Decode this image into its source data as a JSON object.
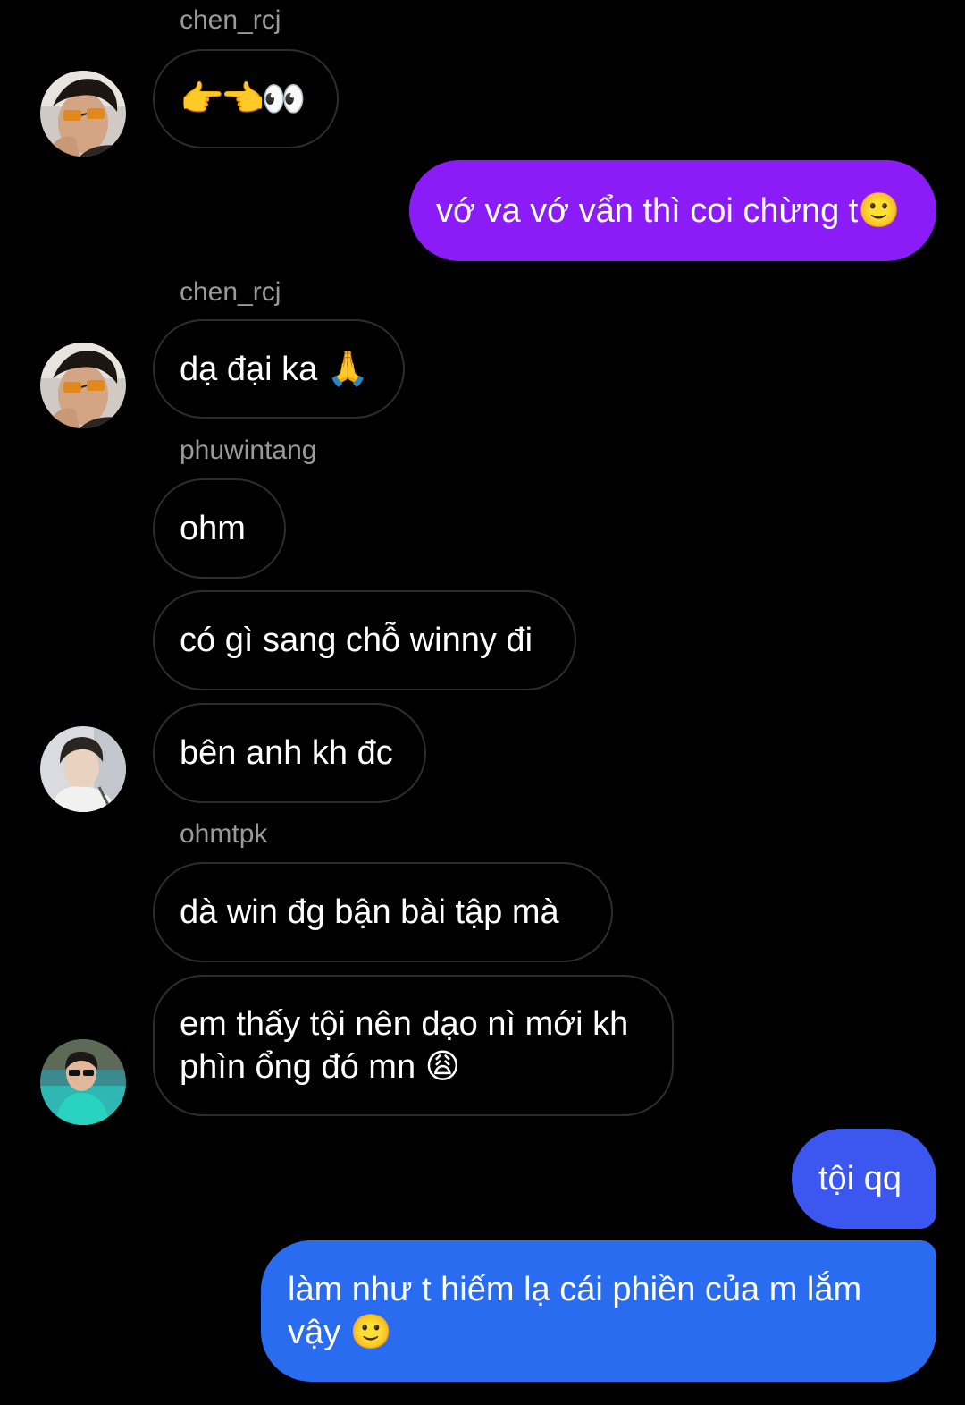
{
  "messages": {
    "m1": {
      "sender": "chen_rcj",
      "text": "👉👈👀"
    },
    "m2": {
      "text": "vớ va vớ vẩn thì coi chừng t🙂"
    },
    "m3": {
      "sender": "chen_rcj",
      "text": "dạ đại ka 🙏"
    },
    "m4": {
      "sender": "phuwintang",
      "text": "ohm"
    },
    "m5": {
      "text": "có gì sang chỗ winny đi"
    },
    "m6": {
      "text": "bên anh kh đc"
    },
    "m7": {
      "sender": "ohmtpk",
      "text": "dà win đg bận bài tập mà"
    },
    "m8": {
      "text": "em thấy tội nên dạo nì mới kh phìn ổng đó mn 😩"
    },
    "m9": {
      "text": "tội qq"
    },
    "m10": {
      "text": "làm như t hiếm lạ cái phiền của m lắm vậy 🙂"
    }
  },
  "colors": {
    "outgoing_purple": "#8c1cf7",
    "outgoing_blue_1": "#3b57ef",
    "outgoing_blue_2": "#2a6cf0",
    "incoming_border": "#2d2d2d",
    "sender_name": "#9a9a9a"
  }
}
